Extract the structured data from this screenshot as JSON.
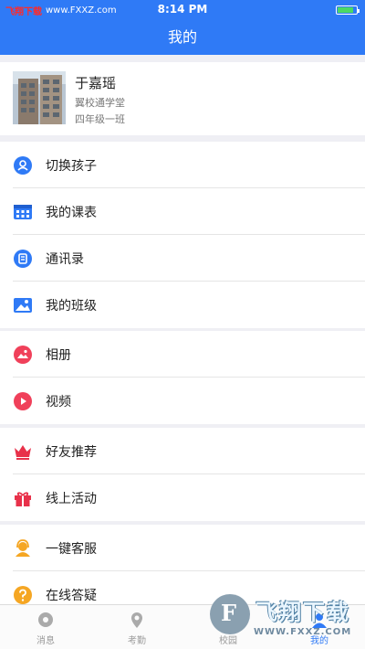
{
  "status_bar": {
    "left_brand": "飞翔下载",
    "left_url": "www.FXXZ.com",
    "time": "8:14 PM",
    "battery_level": 0.85
  },
  "navbar": {
    "title": "我的"
  },
  "profile": {
    "name": "于嘉瑶",
    "school": "翼校通学堂",
    "class": "四年级一班"
  },
  "menu": [
    {
      "label": "切换孩子",
      "icon": "user-switch-icon",
      "color": "#2f7af6"
    },
    {
      "label": "我的课表",
      "icon": "timetable-icon",
      "color": "#2f7af6"
    },
    {
      "label": "通讯录",
      "icon": "contacts-icon",
      "color": "#2f7af6"
    },
    {
      "label": "我的班级",
      "icon": "class-icon",
      "color": "#2f7af6"
    },
    {
      "label": "相册",
      "icon": "album-icon",
      "color": "#f0405a"
    },
    {
      "label": "视频",
      "icon": "video-icon",
      "color": "#f0405a"
    },
    {
      "label": "好友推荐",
      "icon": "crown-icon",
      "color": "#e8314a"
    },
    {
      "label": "线上活动",
      "icon": "gift-icon",
      "color": "#e8314a"
    },
    {
      "label": "一键客服",
      "icon": "customer-service-icon",
      "color": "#f5a623"
    },
    {
      "label": "在线答疑",
      "icon": "question-icon",
      "color": "#f5a623"
    }
  ],
  "tabbar": [
    {
      "label": "消息",
      "icon": "message-icon"
    },
    {
      "label": "考勤",
      "icon": "location-icon"
    },
    {
      "label": "校园",
      "icon": "campus-icon"
    },
    {
      "label": "我的",
      "icon": "profile-icon"
    }
  ],
  "watermark": {
    "text": "飞翔下载",
    "url": "WWW.FXXZ.COM"
  }
}
